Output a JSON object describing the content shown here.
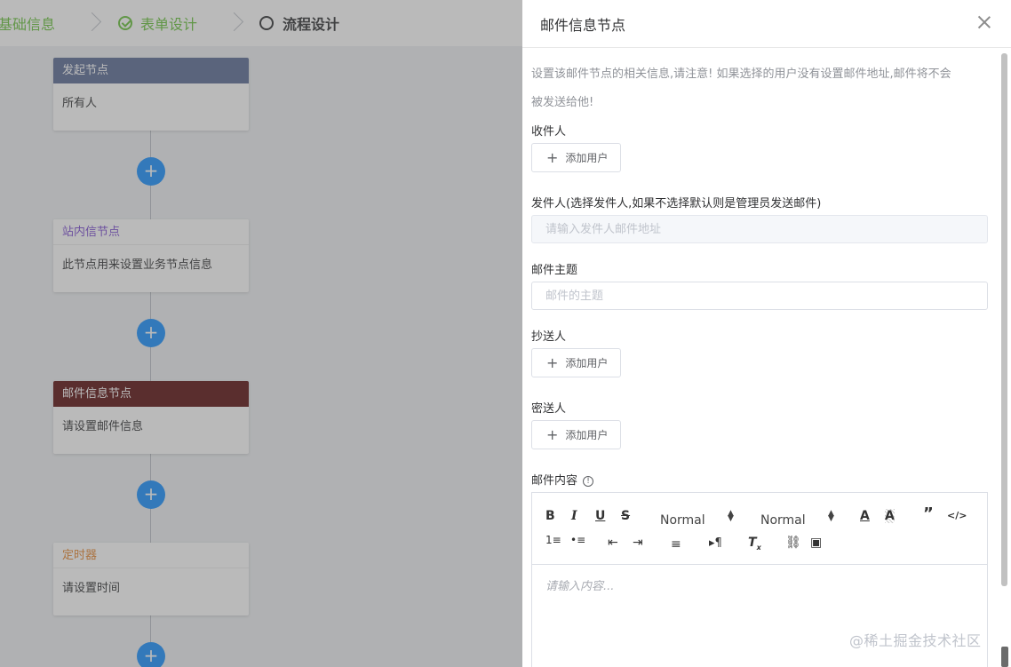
{
  "steps": [
    {
      "label": "基础信息",
      "state": "done"
    },
    {
      "label": "表单设计",
      "state": "done"
    },
    {
      "label": "流程设计",
      "state": "active"
    }
  ],
  "flow": {
    "nodes": [
      {
        "title": "发起节点",
        "body": "所有人",
        "header_color": "#5b6b95",
        "title_color": "#ffffff"
      },
      {
        "title": "站内信节点",
        "body": "此节点用来设置业务节点信息",
        "header_color": "#ffffff",
        "title_color": "#7b4ad1"
      },
      {
        "title": "邮件信息节点",
        "body": "请设置邮件信息",
        "header_color": "#5a0f0f",
        "title_color": "#ffffff"
      },
      {
        "title": "定时器",
        "body": "请设置时间",
        "header_color": "#ffffff",
        "title_color": "#e6862e"
      }
    ],
    "add_symbol": "+"
  },
  "drawer": {
    "title": "邮件信息节点",
    "notice_line1": "设置该邮件节点的相关信息,请注意! 如果选择的用户没有设置邮件地址,邮件将不会",
    "notice_line2": "被发送给他!",
    "recipients_label": "收件人",
    "add_user_label": "添加用户",
    "sender_label": "发件人(选择发件人,如果不选择默认则是管理员发送邮件)",
    "sender_placeholder": "请输入发件人邮件地址",
    "subject_label": "邮件主题",
    "subject_placeholder": "邮件的主题",
    "cc_label": "抄送人",
    "bcc_label": "密送人",
    "content_label": "邮件内容",
    "editor": {
      "header_select": "Normal",
      "size_select": "Normal",
      "placeholder": "请输入内容..."
    }
  },
  "watermark": "@稀土掘金技术社区"
}
